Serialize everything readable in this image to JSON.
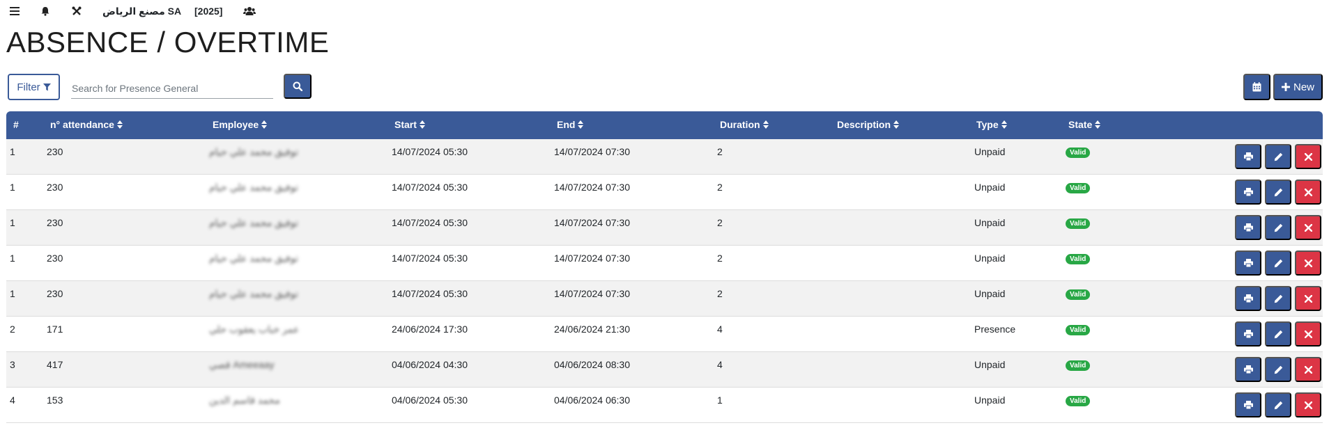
{
  "topbar": {
    "company": "مصنع الرياض SA",
    "year": "[2025]"
  },
  "page": {
    "title": "ABSENCE / OVERTIME"
  },
  "toolbar": {
    "filter_label": "Filter",
    "search_placeholder": "Search for Presence General",
    "new_label": "New"
  },
  "table": {
    "columns": [
      "#",
      "n° attendance",
      "Employee",
      "Start",
      "End",
      "Duration",
      "Description",
      "Type",
      "State"
    ],
    "rows": [
      {
        "num": "1",
        "attendance": "230",
        "employee": "توفيق محمد علي حيام",
        "start": "14/07/2024 05:30",
        "end": "14/07/2024 07:30",
        "duration": "2",
        "description": "",
        "type": "Unpaid",
        "state": "Valid"
      },
      {
        "num": "1",
        "attendance": "230",
        "employee": "توفيق محمد علي حيام",
        "start": "14/07/2024 05:30",
        "end": "14/07/2024 07:30",
        "duration": "2",
        "description": "",
        "type": "Unpaid",
        "state": "Valid"
      },
      {
        "num": "1",
        "attendance": "230",
        "employee": "توفيق محمد علي حيام",
        "start": "14/07/2024 05:30",
        "end": "14/07/2024 07:30",
        "duration": "2",
        "description": "",
        "type": "Unpaid",
        "state": "Valid"
      },
      {
        "num": "1",
        "attendance": "230",
        "employee": "توفيق محمد علي حيام",
        "start": "14/07/2024 05:30",
        "end": "14/07/2024 07:30",
        "duration": "2",
        "description": "",
        "type": "Unpaid",
        "state": "Valid"
      },
      {
        "num": "1",
        "attendance": "230",
        "employee": "توفيق محمد علي حيام",
        "start": "14/07/2024 05:30",
        "end": "14/07/2024 07:30",
        "duration": "2",
        "description": "",
        "type": "Unpaid",
        "state": "Valid"
      },
      {
        "num": "2",
        "attendance": "171",
        "employee": "عمر خباب يعقوب حلي",
        "start": "24/06/2024 17:30",
        "end": "24/06/2024 21:30",
        "duration": "4",
        "description": "",
        "type": "Presence",
        "state": "Valid"
      },
      {
        "num": "3",
        "attendance": "417",
        "employee": "قصي Ameeaay",
        "start": "04/06/2024 04:30",
        "end": "04/06/2024 08:30",
        "duration": "4",
        "description": "",
        "type": "Unpaid",
        "state": "Valid"
      },
      {
        "num": "4",
        "attendance": "153",
        "employee": "محمد قاسم الدين",
        "start": "04/06/2024 05:30",
        "end": "04/06/2024 06:30",
        "duration": "1",
        "description": "",
        "type": "Unpaid",
        "state": "Valid"
      }
    ]
  },
  "colors": {
    "primary": "#3a5a98",
    "danger": "#dc3545",
    "success": "#28a745",
    "row_stripe": "#f2f2f2"
  },
  "icons": [
    "menu-icon",
    "bell-icon",
    "tools-icon",
    "users-icon",
    "filter-icon",
    "search-icon",
    "calendar-icon",
    "plus-icon",
    "print-icon",
    "pencil-icon",
    "close-icon",
    "sort-icon"
  ]
}
